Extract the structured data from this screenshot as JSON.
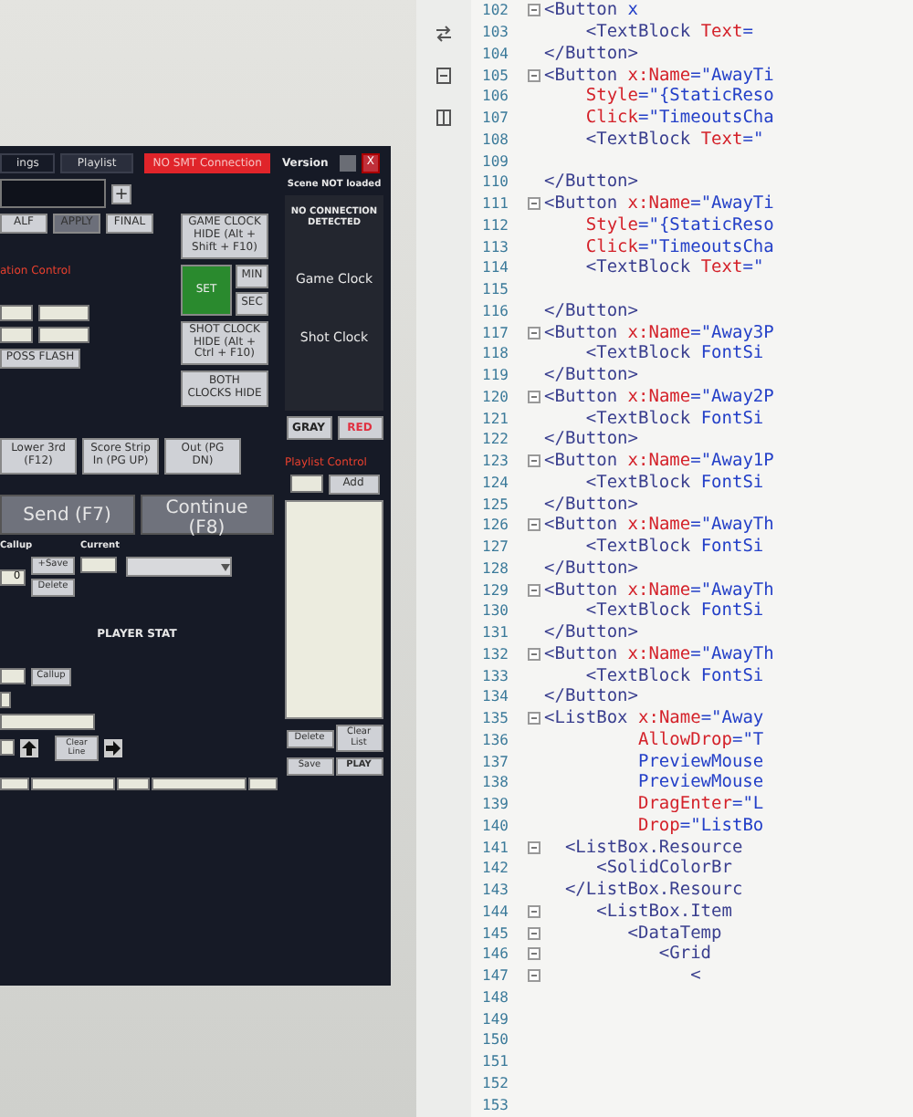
{
  "app": {
    "tabs": [
      {
        "label": "ings",
        "selected": false
      },
      {
        "label": "Playlist",
        "selected": true
      }
    ],
    "connection_badge": "NO SMT Connection",
    "version": "Version",
    "close_label": "X",
    "scene_status": "Scene NOT loaded",
    "score_input": {
      "add": "+"
    },
    "period_buttons": [
      {
        "label": "ALF",
        "disabled": false
      },
      {
        "label": "APPLY",
        "disabled": true
      },
      {
        "label": "FINAL",
        "disabled": false
      }
    ],
    "clock_controls": {
      "game_hide": "GAME CLOCK HIDE (Alt + Shift + F10)",
      "set": {
        "label": "SET",
        "on": true
      },
      "min": "MIN",
      "sec": "SEC",
      "shot_hide": "SHOT CLOCK HIDE (Alt + Ctrl + F10)",
      "both_hide": "BOTH CLOCKS HIDE"
    },
    "clock_display": {
      "status": "NO CONNECTION DETECTED",
      "game": "Game Clock",
      "shot": "Shot Clock"
    },
    "color_buttons": [
      {
        "label": "GRAY",
        "color": "#222222"
      },
      {
        "label": "RED",
        "color": "#e03040"
      }
    ],
    "section_title": "ation Control",
    "poss_flash": "POSS FLASH",
    "graphics_buttons": [
      "Lower 3rd (F12)",
      "Score Strip In (PG UP)",
      "Out (PG DN)"
    ],
    "send": "Send (F7)",
    "continue": "Continue (F8)",
    "callup": {
      "label": "Callup",
      "current_label": "Current",
      "value": "0",
      "save": "+Save",
      "delete": "Delete"
    },
    "playlist": {
      "title": "Playlist Control",
      "add": "Add",
      "buttons": [
        "Delete",
        "Clear List",
        "Save",
        "PLAY"
      ]
    },
    "player_stat": {
      "title": "PLAYER STAT",
      "callup": "Callup",
      "clear": "Clear Line"
    }
  },
  "editor": {
    "lines": [
      {
        "number": "102",
        "code": "<Button x",
        "fold": true
      },
      {
        "number": "103",
        "code": "    <TextBlock Text=",
        "fold": false
      },
      {
        "number": "104",
        "code": "</Button>",
        "fold": false
      },
      {
        "number": "105",
        "code": "<Button x:Name=\"AwayTi",
        "fold": true
      },
      {
        "number": "106",
        "code": "    Style=\"{StaticReso",
        "fold": false
      },
      {
        "number": "107",
        "code": "    Click=\"TimeoutsCha",
        "fold": false
      },
      {
        "number": "108",
        "code": "    <TextBlock Text=\"",
        "fold": false
      },
      {
        "number": "109",
        "fold": false
      },
      {
        "number": "110",
        "code": "</Button>",
        "fold": false
      },
      {
        "number": "111",
        "code": "<Button x:Name=\"AwayTi",
        "fold": true
      },
      {
        "number": "112",
        "code": "    Style=\"{StaticReso",
        "fold": false
      },
      {
        "number": "113",
        "code": "    Click=\"TimeoutsCha",
        "fold": false
      },
      {
        "number": "114",
        "code": "    <TextBlock Text=\"",
        "fold": false
      },
      {
        "number": "115",
        "fold": false
      },
      {
        "number": "116",
        "code": "</Button>",
        "fold": false
      },
      {
        "number": "117",
        "code": "<Button x:Name=\"Away3P",
        "fold": true
      },
      {
        "number": "118",
        "code": "    <TextBlock FontSi",
        "fold": false
      },
      {
        "number": "119",
        "code": "</Button>",
        "fold": false
      },
      {
        "number": "120",
        "code": "<Button x:Name=\"Away2P",
        "fold": true
      },
      {
        "number": "121",
        "code": "    <TextBlock FontSi",
        "fold": false
      },
      {
        "number": "122",
        "code": "</Button>",
        "fold": false
      },
      {
        "number": "123",
        "code": "<Button x:Name=\"Away1P",
        "fold": true
      },
      {
        "number": "124",
        "code": "    <TextBlock FontSi",
        "fold": false
      },
      {
        "number": "125",
        "code": "</Button>",
        "fold": false
      },
      {
        "number": "126",
        "code": "<Button x:Name=\"AwayTh",
        "fold": true
      },
      {
        "number": "127",
        "code": "    <TextBlock FontSi",
        "fold": false
      },
      {
        "number": "128",
        "code": "</Button>",
        "fold": false
      },
      {
        "number": "129",
        "code": "<Button x:Name=\"AwayTh",
        "fold": true
      },
      {
        "number": "130",
        "code": "    <TextBlock FontSi",
        "fold": false
      },
      {
        "number": "131",
        "code": "</Button>",
        "fold": false
      },
      {
        "number": "132",
        "code": "<Button x:Name=\"AwayTh",
        "fold": true
      },
      {
        "number": "133",
        "code": "    <TextBlock FontSi",
        "fold": false
      },
      {
        "number": "134",
        "code": "</Button>",
        "fold": false
      },
      {
        "number": "135",
        "code": "<ListBox x:Name=\"Away",
        "fold": true
      },
      {
        "number": "136",
        "code": "         AllowDrop=\"T",
        "fold": false
      },
      {
        "number": "137",
        "code": "         PreviewMouse",
        "fold": false
      },
      {
        "number": "138",
        "code": "         PreviewMouse",
        "fold": false
      },
      {
        "number": "139",
        "code": "         DragEnter=\"L",
        "fold": false
      },
      {
        "number": "140",
        "code": "         Drop=\"ListBo",
        "fold": false
      },
      {
        "number": "141",
        "code": "  <ListBox.Resource",
        "fold": true
      },
      {
        "number": "142",
        "code": "     <SolidColorBr",
        "fold": false
      },
      {
        "number": "143",
        "code": "  </ListBox.Resourc",
        "fold": false
      },
      {
        "number": "144",
        "code": "     <ListBox.Item",
        "fold": true
      },
      {
        "number": "145",
        "code": "        <DataTemp",
        "fold": true
      },
      {
        "number": "146",
        "code": "           <Grid",
        "fold": true
      },
      {
        "number": "147",
        "code": "              <",
        "fold": true
      },
      {
        "number": "148",
        "fold": false
      },
      {
        "number": "149",
        "fold": false
      },
      {
        "number": "150",
        "fold": false
      },
      {
        "number": "151",
        "fold": false
      },
      {
        "number": "152",
        "fold": false
      },
      {
        "number": "153",
        "fold": false
      }
    ]
  }
}
